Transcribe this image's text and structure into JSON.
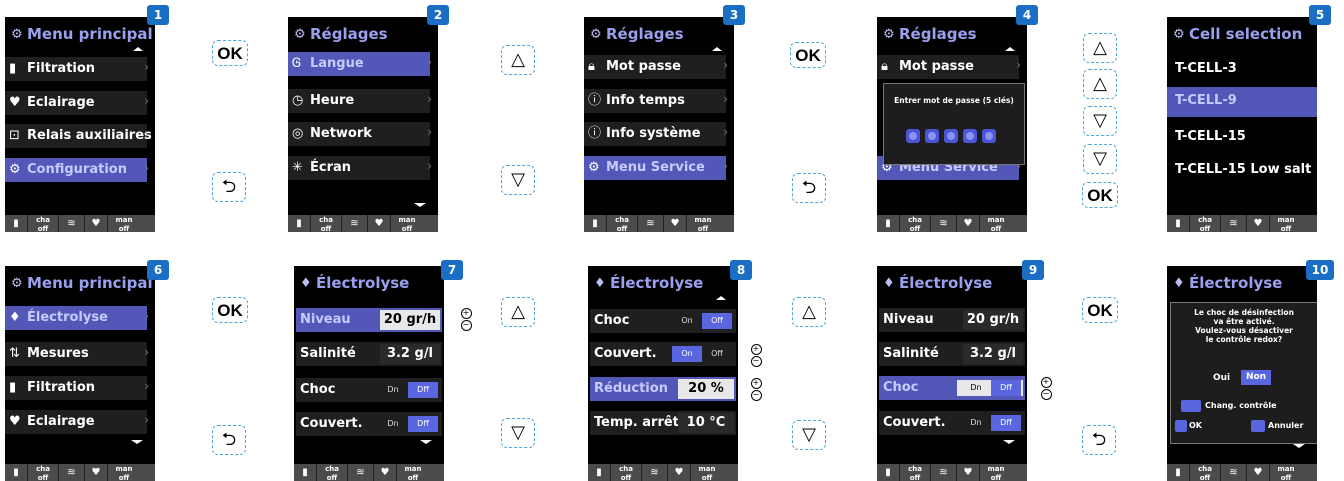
{
  "colors": {
    "accent": "#5358b8",
    "badge": "#1a6fc4",
    "header_text": "#9aa0ee",
    "button_border": "#4aa5d8"
  },
  "footer": {
    "cells": [
      {
        "icon": "bulb-filter-icon",
        "label": ""
      },
      {
        "icon": "",
        "label": "cha\noff"
      },
      {
        "icon": "wifi-icon",
        "label": ""
      },
      {
        "icon": "bulb-icon",
        "label": ""
      },
      {
        "icon": "",
        "label": "man\noff"
      }
    ],
    "cha": "cha",
    "man": "man",
    "off": "off"
  },
  "buttons": {
    "ok": "OK",
    "up": "△",
    "down": "▽",
    "back": "⮌"
  },
  "screens": [
    {
      "badge": "1",
      "title": "Menu principal",
      "items": [
        "Filtration",
        "Eclairage",
        "Relais auxiliaires",
        "Configuration"
      ]
    },
    {
      "badge": "2",
      "title": "Réglages",
      "items": [
        "Langue",
        "Heure",
        "Network",
        "Écran"
      ]
    },
    {
      "badge": "3",
      "title": "Réglages",
      "items": [
        "Mot passe",
        "Info temps",
        "Info système",
        "Menu Service"
      ]
    },
    {
      "badge": "4",
      "title": "Réglages",
      "items": [
        "Mot passe",
        "Menu Service"
      ],
      "popup": "Entrer mot de passe (5 clés)"
    },
    {
      "badge": "5",
      "title": "Cell selection",
      "items": [
        "T-CELL-3",
        "T-CELL-9",
        "T-CELL-15",
        "T-CELL-15 Low salt"
      ]
    },
    {
      "badge": "6",
      "title": "Menu principal",
      "items": [
        "Électrolyse",
        "Mesures",
        "Filtration",
        "Eclairage"
      ]
    },
    {
      "badge": "7",
      "title": "Électrolyse",
      "items": [
        "Niveau",
        "Salinité",
        "Choc",
        "Couvert."
      ],
      "values": [
        "20 gr/h",
        "3.2 g/l"
      ]
    },
    {
      "badge": "8",
      "title": "Électrolyse",
      "items": [
        "Choc",
        "Couvert.",
        "Réduction",
        "Temp. arrêt"
      ],
      "values": [
        "20 %",
        "10 °C"
      ]
    },
    {
      "badge": "9",
      "title": "Électrolyse",
      "items": [
        "Niveau",
        "Salinité",
        "Choc",
        "Couvert."
      ],
      "values": [
        "20 gr/h",
        "3.2 g/l"
      ]
    },
    {
      "badge": "10",
      "title": "Électrolyse",
      "popup_lines": [
        "Le choc de désinfection",
        "va être activé.",
        "Voulez-vous désactiver",
        "le contrôle redox?"
      ],
      "popup_yes": "Oui",
      "popup_no": "Non",
      "popup_change": "Chang. contrôle",
      "popup_ok": "OK",
      "popup_cancel": "Annuler"
    }
  ],
  "toggle": {
    "on": "On",
    "on_alt": "Dn",
    "off": "Off",
    "off_alt": "Dff"
  }
}
